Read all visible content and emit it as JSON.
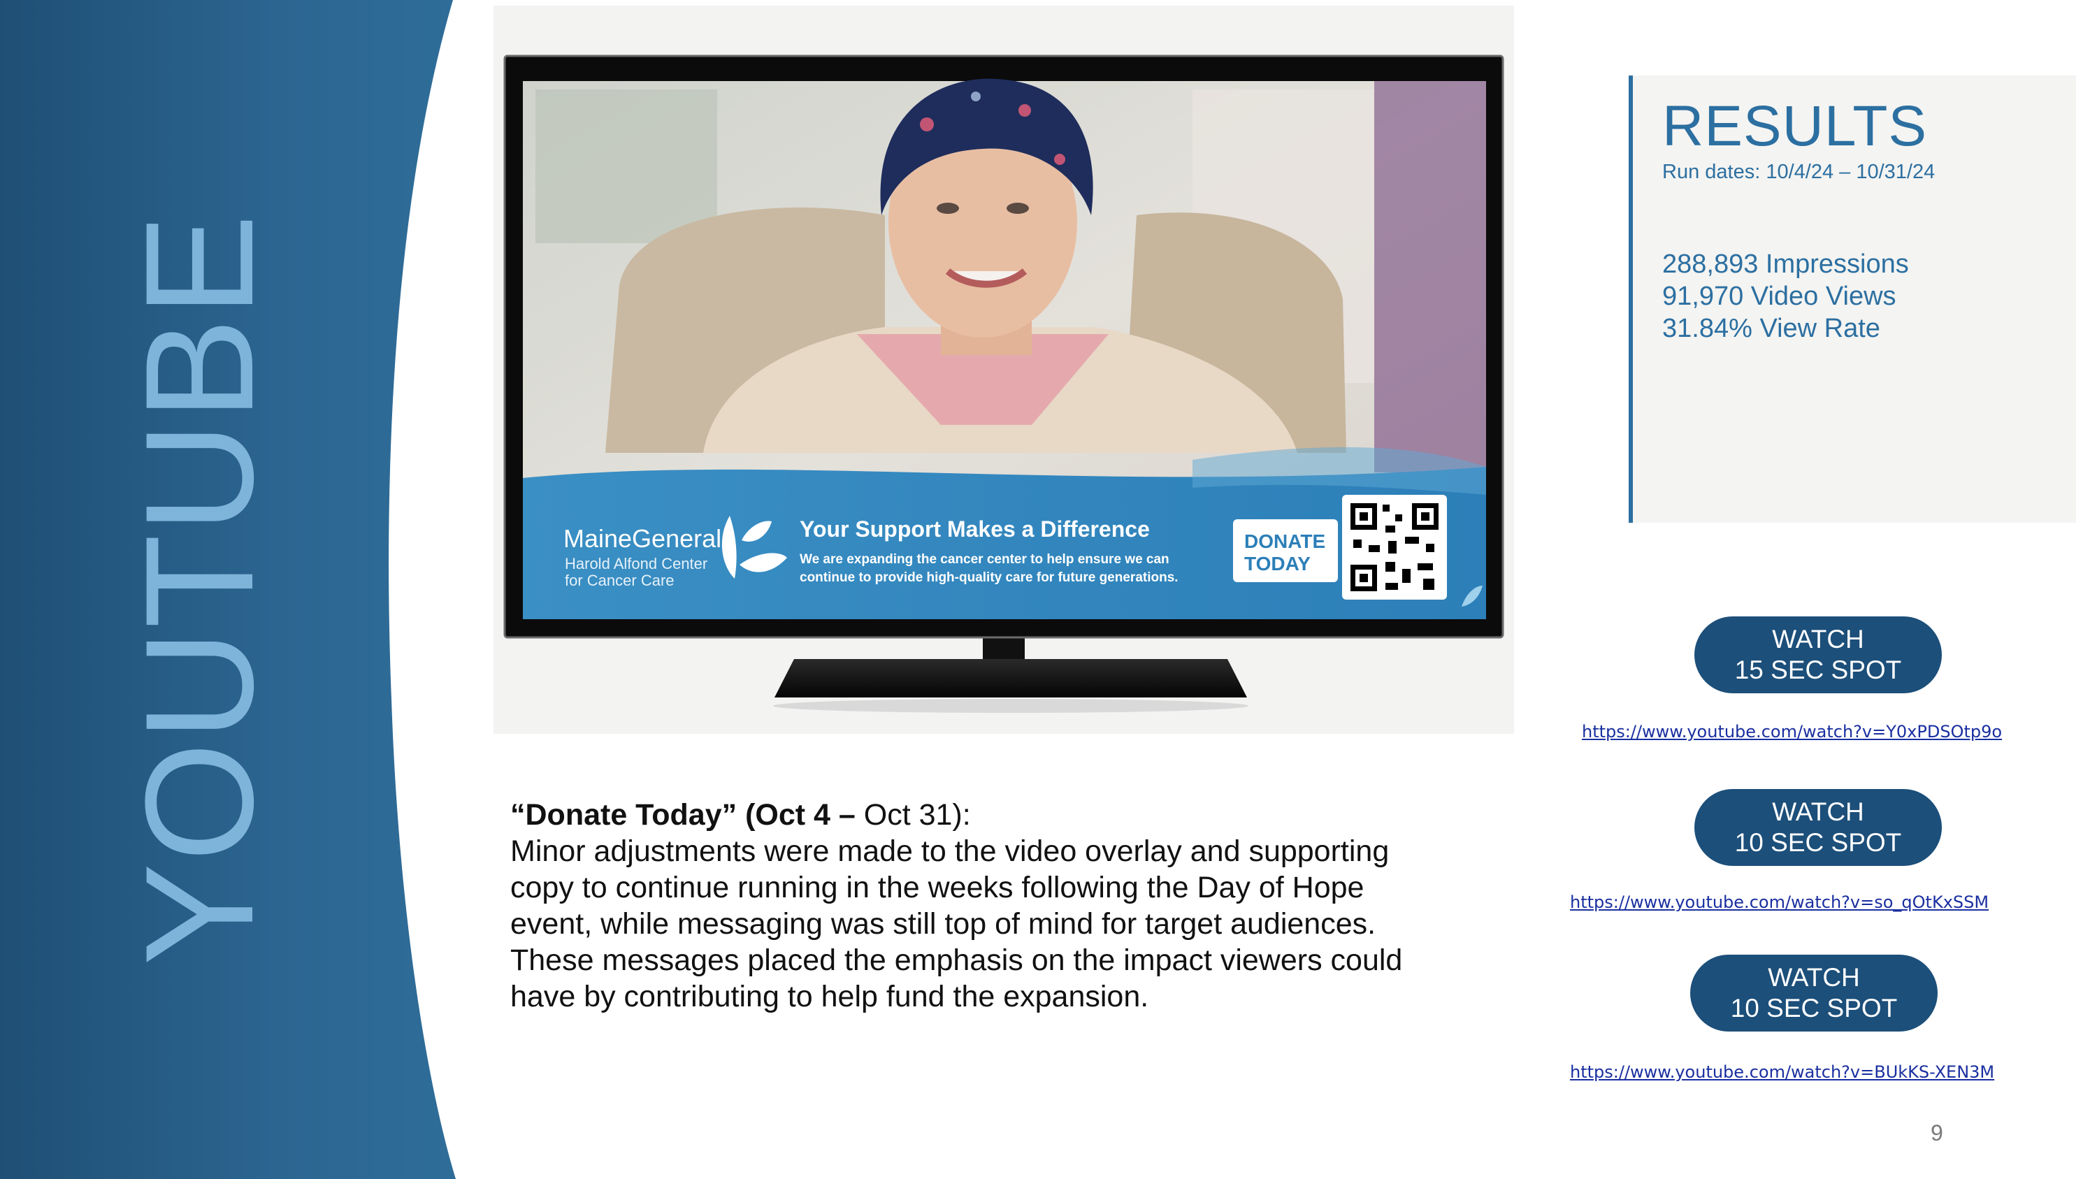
{
  "colors": {
    "panel_dark": "#1d4a6e",
    "panel_mid": "#2f6c96",
    "side_title": "#7fb4da",
    "accent_blue": "#2c6fa1",
    "button_blue": "#1c4f7a",
    "link_blue": "#1a2fa0"
  },
  "side_panel": {
    "title": "YOUTUBE"
  },
  "tv": {
    "banner": {
      "brand_name": "MaineGeneral",
      "brand_sub_1": "Harold Alfond Center",
      "brand_sub_2": "for Cancer Care",
      "headline": "Your Support Makes a Difference",
      "body_line_1": "We are expanding the cancer center to help ensure we can",
      "body_line_2": "continue to provide high-quality care for future generations.",
      "donate_line_1": "DONATE",
      "donate_line_2": "TODAY"
    }
  },
  "description": {
    "title_bold": "“Donate Today” (Oct 4 –",
    "title_rest": " Oct 31):",
    "lines": [
      "Minor adjustments were made to the video overlay and supporting",
      "copy to continue running in the weeks following the Day of Hope",
      "event, while messaging was still top of mind for target audiences.",
      "These messages placed the emphasis on the impact viewers could",
      "have by contributing to help fund the expansion."
    ]
  },
  "results": {
    "title": "RESULTS",
    "run_dates": "Run dates: 10/4/24 – 10/31/24",
    "stats": [
      "288,893 Impressions",
      "91,970 Video Views",
      "31.84% View Rate"
    ]
  },
  "watch": [
    {
      "line1": "WATCH",
      "line2": "15 SEC SPOT",
      "url": "https://www.youtube.com/watch?v=Y0xPDSOtp9o"
    },
    {
      "line1": "WATCH",
      "line2": "10 SEC SPOT",
      "url": "https://www.youtube.com/watch?v=so_qOtKxSSM"
    },
    {
      "line1": "WATCH",
      "line2": "10 SEC SPOT",
      "url": "https://www.youtube.com/watch?v=BUkKS-XEN3M"
    }
  ],
  "page_number": "9"
}
